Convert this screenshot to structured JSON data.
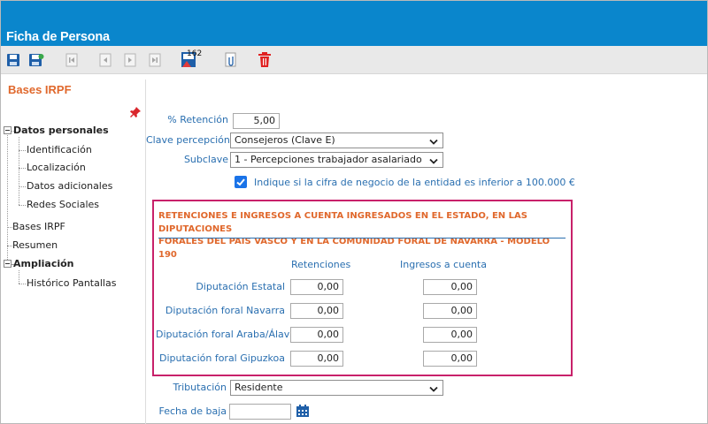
{
  "window": {
    "title": "Ficha de Persona"
  },
  "toolbar": {
    "buttons": [
      {
        "name": "save-icon"
      },
      {
        "name": "save-as-icon"
      },
      {
        "name": "first-record-icon"
      },
      {
        "name": "previous-record-icon"
      },
      {
        "name": "next-record-icon"
      },
      {
        "name": "last-record-icon"
      },
      {
        "name": "model-162-icon",
        "badge": "162"
      },
      {
        "name": "attachment-icon"
      },
      {
        "name": "delete-icon"
      }
    ]
  },
  "section": {
    "title": "Bases IRPF"
  },
  "tree": {
    "datos_personales": "Datos personales",
    "identificacion": "Identificación",
    "localizacion": "Localización",
    "datos_adicionales": "Datos adicionales",
    "redes_sociales": "Redes Sociales",
    "bases_irpf": "Bases IRPF",
    "resumen": "Resumen",
    "ampliacion": "Ampliación",
    "historico": "Histórico Pantallas"
  },
  "form": {
    "retencion_label": "% Retención",
    "retencion_value": "5,00",
    "clave_label": "Clave percepción",
    "clave_value": "Consejeros (Clave E)",
    "subclave_label": "Subclave",
    "subclave_value": "1 - Percepciones trabajador asalariado",
    "checkbox_label": "Indique si la cifra de negocio de la entidad es inferior a 100.000 €",
    "tributacion_label": "Tributación",
    "tributacion_value": "Residente",
    "fecha_baja_label": "Fecha de baja",
    "fecha_baja_value": ""
  },
  "modelo190": {
    "header_line1": "RETENCIONES E INGRESOS A CUENTA INGRESADOS EN EL ESTADO, EN LAS DIPUTACIONES",
    "header_line2": "FORALES DEL PAIS VASCO Y EN LA COMUNIDAD FORAL DE NAVARRA - MODELO 190",
    "col_retenciones": "Retenciones",
    "col_ingresos": "Ingresos a cuenta",
    "rows": [
      {
        "label": "Diputación Estatal",
        "retenciones": "0,00",
        "ingresos": "0,00"
      },
      {
        "label": "Diputación foral Navarra",
        "retenciones": "0,00",
        "ingresos": "0,00"
      },
      {
        "label": "Diputación foral Araba/Álava",
        "retenciones": "0,00",
        "ingresos": "0,00"
      },
      {
        "label": "Diputación foral Gipuzkoa",
        "retenciones": "0,00",
        "ingresos": "0,00"
      }
    ]
  },
  "colors": {
    "titlebar": "#0a86cc",
    "accent_orange": "#e0682c",
    "label_blue": "#2a6fb0",
    "box_border": "#c8216a",
    "delete_red": "#e02020"
  }
}
